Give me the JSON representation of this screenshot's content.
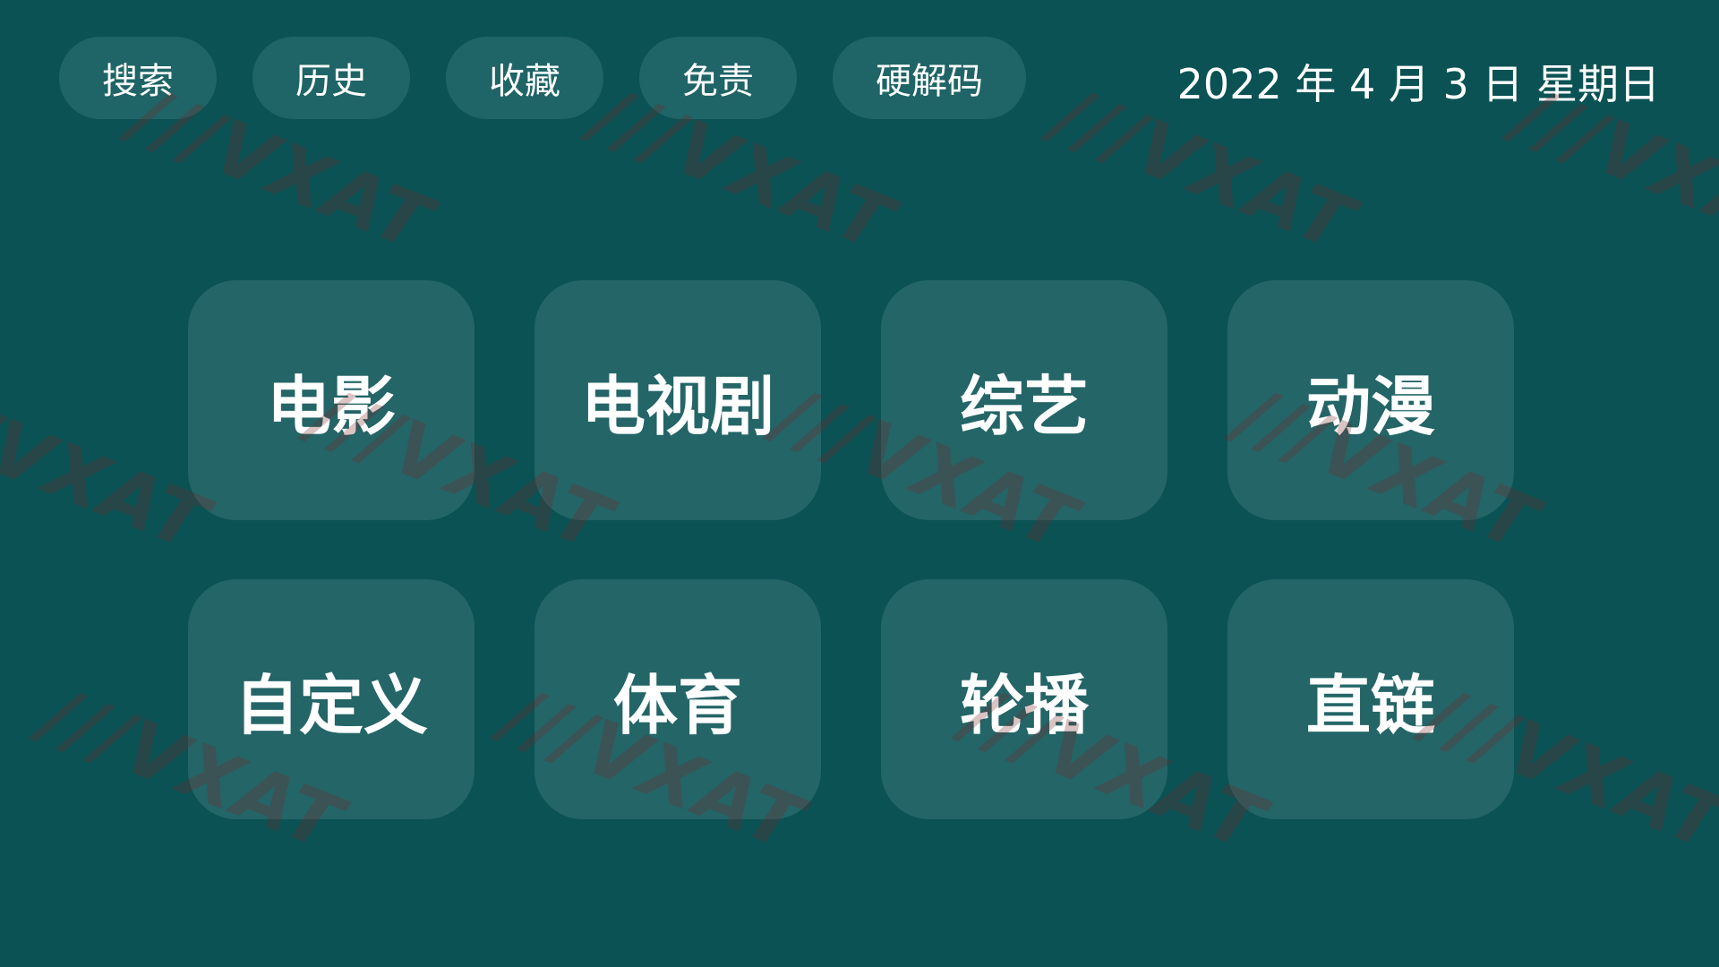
{
  "nav": {
    "items": [
      {
        "label": "搜索"
      },
      {
        "label": "历史"
      },
      {
        "label": "收藏"
      },
      {
        "label": "免责"
      },
      {
        "label": "硬解码"
      }
    ]
  },
  "date_text": "2022 年 4 月 3 日 星期日",
  "categories": [
    {
      "label": "电影"
    },
    {
      "label": "电视剧"
    },
    {
      "label": "综艺"
    },
    {
      "label": "动漫"
    },
    {
      "label": "自定义"
    },
    {
      "label": "体育"
    },
    {
      "label": "轮播"
    },
    {
      "label": "直链"
    }
  ],
  "watermark": "///VXAT",
  "colors": {
    "background": "#0b5254",
    "pill": "#1f6466",
    "tile": "#246567",
    "text": "#ffffff"
  }
}
